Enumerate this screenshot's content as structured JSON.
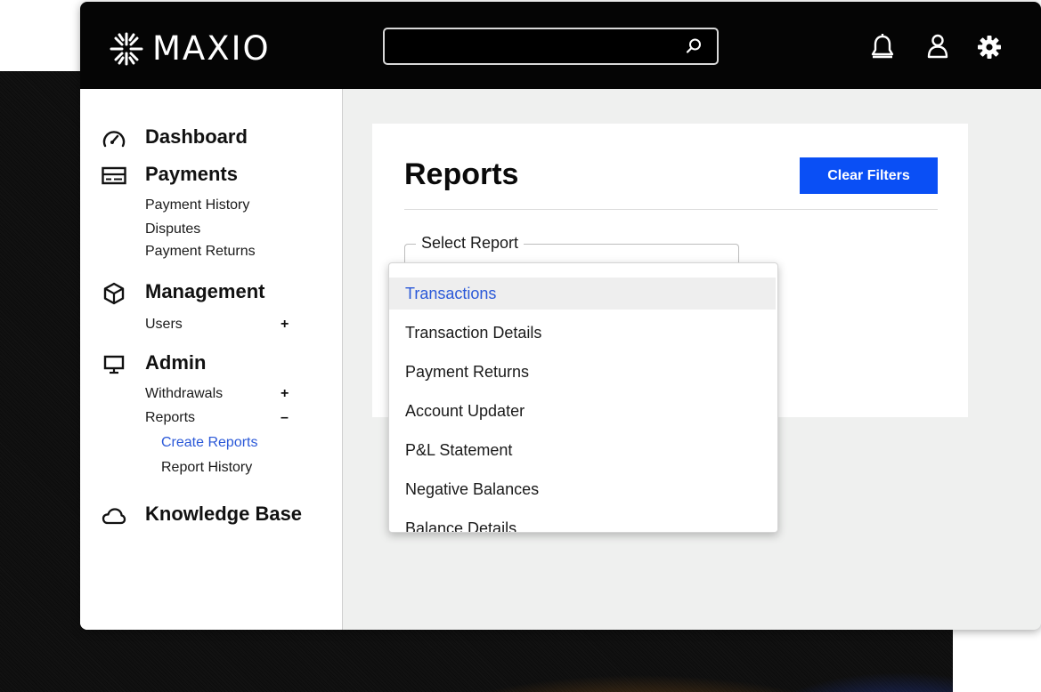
{
  "brand": {
    "name": "MAXIO"
  },
  "search": {
    "placeholder": ""
  },
  "sidebar": {
    "dashboard": "Dashboard",
    "payments": {
      "label": "Payments",
      "items": [
        "Payment History",
        "Disputes",
        "Payment Returns"
      ]
    },
    "management": {
      "label": "Management",
      "items": [
        {
          "label": "Users",
          "toggle": "+"
        }
      ]
    },
    "admin": {
      "label": "Admin",
      "items": [
        {
          "label": "Withdrawals",
          "toggle": "+"
        },
        {
          "label": "Reports",
          "toggle": "–"
        }
      ],
      "reports_sub": [
        {
          "label": "Create Reports",
          "active": true
        },
        {
          "label": "Report History",
          "active": false
        }
      ]
    },
    "knowledge_base": "Knowledge Base"
  },
  "main": {
    "title": "Reports",
    "clear_filters": "Clear Filters",
    "select_label": "Select Report",
    "dropdown_options": [
      "Transactions",
      "Transaction Details",
      "Payment Returns",
      "Account Updater",
      "P&L Statement",
      "Negative Balances",
      "Balance Details"
    ],
    "selected_option": "Transactions"
  },
  "colors": {
    "accent_blue": "#0a4ff5",
    "active_link": "#2b59d8",
    "topbar": "#050505"
  }
}
